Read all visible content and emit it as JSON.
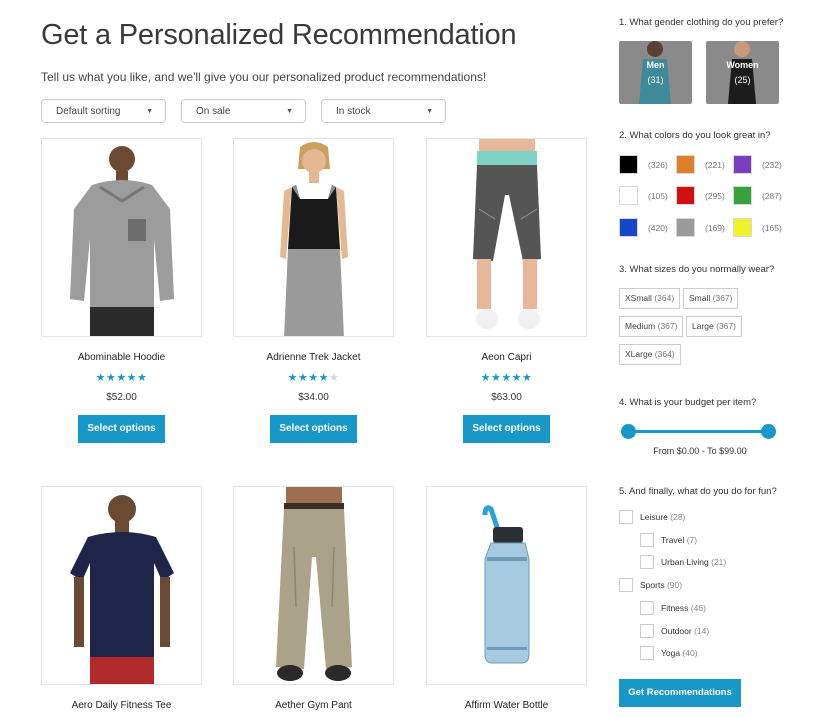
{
  "page": {
    "title": "Get a Personalized Recommendation",
    "subtitle": "Tell us what you like, and we'll give you our personalized product recommendations!"
  },
  "filters": [
    {
      "label": "Default sorting"
    },
    {
      "label": "On sale"
    },
    {
      "label": "In stock"
    }
  ],
  "products": [
    {
      "name": "Abominable Hoodie",
      "rating": 5,
      "price": "$52.00",
      "button": "Select options"
    },
    {
      "name": "Adrienne Trek Jacket",
      "rating": 4,
      "price": "$34.00",
      "button": "Select options"
    },
    {
      "name": "Aeon Capri",
      "rating": 5,
      "price": "$63.00",
      "button": "Select options"
    },
    {
      "name": "Aero Daily Fitness Tee"
    },
    {
      "name": "Aether Gym Pant"
    },
    {
      "name": "Affirm Water Bottle"
    }
  ],
  "quiz": {
    "q1": "1. What gender clothing do you prefer?",
    "genders": [
      {
        "label": "Men",
        "count": "(31)"
      },
      {
        "label": "Women",
        "count": "(25)"
      }
    ],
    "q2": "2. What colors do you look great in?",
    "colors": [
      {
        "color": "#000000",
        "count": "(326)"
      },
      {
        "color": "#e07f2a",
        "count": "(221)"
      },
      {
        "color": "#7a3dbb",
        "count": "(232)"
      },
      {
        "color": "#ffffff",
        "count": "(105)"
      },
      {
        "color": "#d10f0f",
        "count": "(295)"
      },
      {
        "color": "#36a23a",
        "count": "(287)"
      },
      {
        "color": "#1547c8",
        "count": "(420)"
      },
      {
        "color": "#9b9b9b",
        "count": "(169)"
      },
      {
        "color": "#f1f12a",
        "count": "(165)"
      }
    ],
    "q3": "3. What sizes do you normally wear?",
    "sizes": [
      {
        "label": "XSmall",
        "count": "(364)"
      },
      {
        "label": "Small",
        "count": "(367)"
      },
      {
        "label": "Medium",
        "count": "(367)"
      },
      {
        "label": "Large",
        "count": "(367)"
      },
      {
        "label": "XLarge",
        "count": "(364)"
      }
    ],
    "q4": "4. What is your budget per item?",
    "budget": {
      "text": "From $0.00 - To $99.00",
      "min": 0,
      "max": 99
    },
    "q5": "5. And finally, what do you do for fun?",
    "interests": [
      {
        "label": "Leisure",
        "count": "(28)"
      },
      {
        "label": "Travel",
        "count": "(7)"
      },
      {
        "label": "Urban Living",
        "count": "(21)"
      },
      {
        "label": "Sports",
        "count": "(90)"
      },
      {
        "label": "Fitness",
        "count": "(46)"
      },
      {
        "label": "Outdoor",
        "count": "(14)"
      },
      {
        "label": "Yoga",
        "count": "(40)"
      }
    ],
    "submit": "Get Recommendations"
  },
  "accent_color": "#1897c9"
}
